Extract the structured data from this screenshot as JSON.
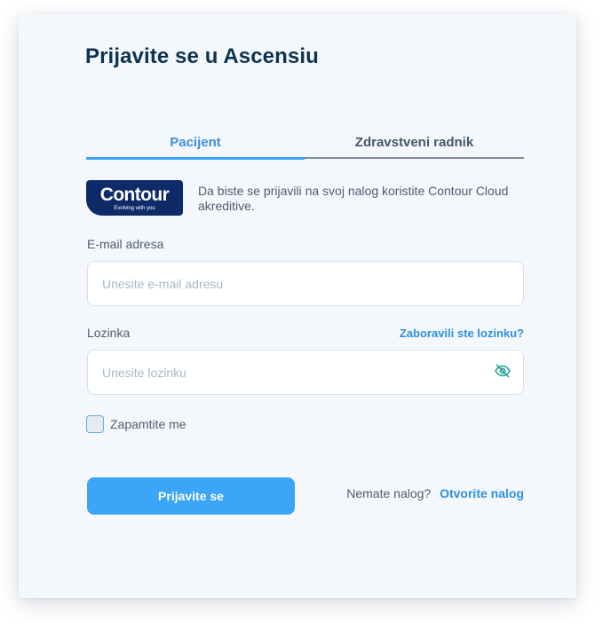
{
  "page": {
    "title": "Prijavite se u Ascensiu"
  },
  "tabs": [
    {
      "label": "Pacijent",
      "active": true
    },
    {
      "label": "Zdravstveni radnik",
      "active": false
    }
  ],
  "logo": {
    "name": "Contour",
    "tagline": "Evolving with you",
    "color": "#0f2a68"
  },
  "info": {
    "text": "Da biste se prijavili na svoj nalog koristite Contour Cloud akreditive."
  },
  "email": {
    "label": "E-mail adresa",
    "placeholder": "Unesite e-mail adresu",
    "value": ""
  },
  "password": {
    "label": "Lozinka",
    "placeholder": "Unesite lozinku",
    "value": "",
    "forgot_link": "Zaboravili ste lozinku?",
    "toggle_icon": "eye-off-icon"
  },
  "remember": {
    "label": "Zapamtite me",
    "checked": false
  },
  "submit": {
    "label": "Prijavite se"
  },
  "signup": {
    "question": "Nemate nalog?",
    "link": "Otvorite nalog"
  },
  "colors": {
    "accent": "#3aa6f8",
    "link": "#2d8fe0",
    "title": "#0e3350",
    "card_bg": "#f4f8fd"
  }
}
